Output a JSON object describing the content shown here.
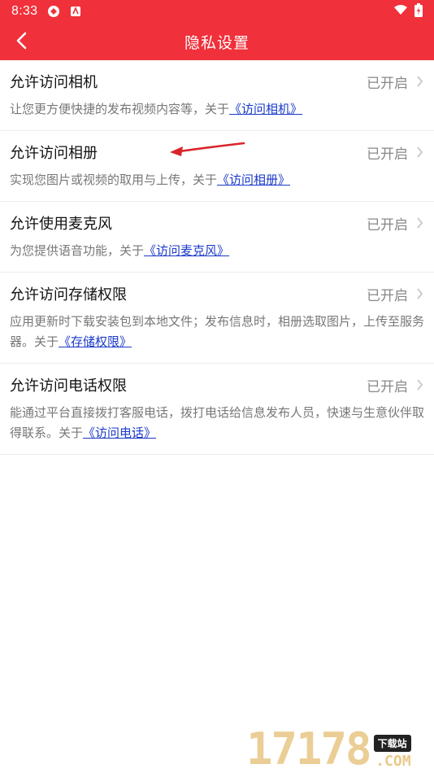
{
  "status_bar": {
    "time": "8:33",
    "left_icons": [
      "sync-icon",
      "app-notification-icon"
    ],
    "right_icons": [
      "wifi-icon",
      "battery-charging-icon"
    ]
  },
  "app_bar": {
    "title": "隐私设置",
    "back_icon": "chevron-left-icon"
  },
  "settings": [
    {
      "name": "允许访问相机",
      "state": "已开启",
      "desc_prefix": "让您更方便快捷的发布视频内容等，关于",
      "link": "《访问相机》",
      "desc_suffix": ""
    },
    {
      "name": "允许访问相册",
      "state": "已开启",
      "desc_prefix": "实现您图片或视频的取用与上传，关于",
      "link": "《访问相册》",
      "desc_suffix": ""
    },
    {
      "name": "允许使用麦克风",
      "state": "已开启",
      "desc_prefix": "为您提供语音功能，关于",
      "link": "《访问麦克风》",
      "desc_suffix": ""
    },
    {
      "name": "允许访问存储权限",
      "state": "已开启",
      "desc_prefix": "应用更新时下载安装包到本地文件；发布信息时，相册选取图片，上传至服务器。关于",
      "link": "《存储权限》",
      "desc_suffix": ""
    },
    {
      "name": "允许访问电话权限",
      "state": "已开启",
      "desc_prefix": "能通过平台直接拨打客服电话，拨打电话给信息发布人员，快速与生意伙伴取得联系。关于",
      "link": "《访问电话》",
      "desc_suffix": ""
    }
  ],
  "watermark": {
    "number": "17178",
    "tag": "下载站",
    "domain": ".COM"
  },
  "colors": {
    "brand_red": "#f0303a",
    "link_blue": "#1a39c8",
    "annotation_arrow": "#d9252a",
    "watermark_gold": "#e9c98a"
  }
}
